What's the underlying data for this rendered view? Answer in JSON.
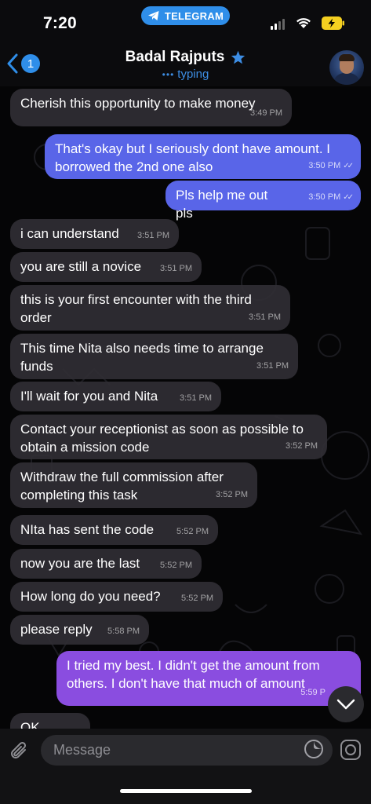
{
  "status_bar": {
    "time": "7:20",
    "telegram_pill": "TELEGRAM"
  },
  "header": {
    "back_badge": "1",
    "title": "Badal Rajputs",
    "subtitle": "typing",
    "back_icon": "chevron-left-icon",
    "star_icon": "star-icon"
  },
  "colors": {
    "accent": "#2f8ee9",
    "outgoing_bubble": "#5965e8",
    "outgoing_bubble_purple": "#8a4de0",
    "incoming_bubble": "#302e34",
    "background": "#050506"
  },
  "messages": [
    {
      "dir": "in",
      "text": "Cherish this opportunity to make money",
      "time": "3:49 PM"
    },
    {
      "dir": "out",
      "text": "That's okay but I seriously dont have amount. I borrowed the 2nd one also",
      "time": "3:50 PM",
      "read": true
    },
    {
      "dir": "out",
      "text": "Pls help me out pls",
      "time": "3:50 PM",
      "read": true
    },
    {
      "dir": "in",
      "text": "i can understand",
      "time": "3:51 PM"
    },
    {
      "dir": "in",
      "text": "you are still a novice",
      "time": "3:51 PM"
    },
    {
      "dir": "in",
      "text": "this is your first encounter with the third order",
      "time": "3:51 PM"
    },
    {
      "dir": "in",
      "text": "This time Nita also needs time to arrange funds",
      "time": "3:51 PM"
    },
    {
      "dir": "in",
      "text": "I'll wait for you and Nita",
      "time": "3:51 PM"
    },
    {
      "dir": "in",
      "text": "Contact your receptionist as soon as possible to obtain a mission code",
      "time": "3:52 PM"
    },
    {
      "dir": "in",
      "text": "Withdraw the full commission after completing this task",
      "time": "3:52 PM"
    },
    {
      "dir": "in",
      "text": "NIta has sent the code",
      "time": "5:52 PM"
    },
    {
      "dir": "in",
      "text": "now you are the last",
      "time": "5:52 PM"
    },
    {
      "dir": "in",
      "text": "How long do you need?",
      "time": "5:52 PM"
    },
    {
      "dir": "in",
      "text": "please reply",
      "time": "5:58 PM"
    },
    {
      "dir": "out",
      "text": "I tried my best. I didn't get the amount from others. I don't have that much of amount",
      "time": "5:59 P",
      "read": false
    },
    {
      "dir": "in",
      "text": "OK",
      "time": ""
    }
  ],
  "input": {
    "placeholder": "Message",
    "attach_icon": "paperclip-icon",
    "sticker_icon": "sticker-icon",
    "camera_icon": "camera-icon",
    "scroll_icon": "chevron-down-icon"
  }
}
